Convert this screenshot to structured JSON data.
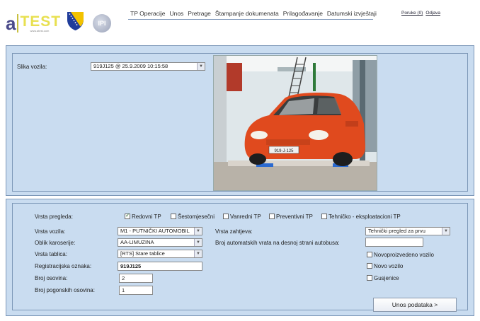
{
  "logo": {
    "letter": "a",
    "word": "TEST",
    "sub": "www.atest.com",
    "badge": "IPI"
  },
  "nav": {
    "items": [
      "TP Operacije",
      "Unos",
      "Pretrage",
      "Štampanje dokumenata",
      "Prilagođavanje",
      "Datumski izvještaji"
    ],
    "messages": "Poruke (0)",
    "logout": "Odjava"
  },
  "vehicle_image": {
    "label": "Slika vozila:",
    "selected": "919J125 @ 25.9.2009 10:15:58",
    "plate_text": "919-J-125"
  },
  "form": {
    "inspection_type_label": "Vrsta pregleda:",
    "inspection_types": [
      {
        "label": "Redovni TP",
        "checked": true
      },
      {
        "label": "Šestomjesečni",
        "checked": false
      },
      {
        "label": "Vanredni TP",
        "checked": false
      },
      {
        "label": "Preventivni TP",
        "checked": false
      },
      {
        "label": "Tehničko - eksploatacioni TP",
        "checked": false
      }
    ],
    "vehicle_type_label": "Vrsta vozila:",
    "vehicle_type_value": "M1 - PUTNIČKI AUTOMOBIL",
    "body_shape_label": "Oblik karoserije:",
    "body_shape_value": "AA-LIMUZINA",
    "plate_type_label": "Vrsta tablica:",
    "plate_type_value": "[RTS] Stare tablice",
    "registration_label": "Registracijska oznaka:",
    "registration_value": "919J125",
    "axles_label": "Broj osovina:",
    "axles_value": "2",
    "drive_axles_label": "Broj pogonskih osovina:",
    "drive_axles_value": "1",
    "request_type_label": "Vrsta zahtjeva:",
    "request_type_value": "Tehnički pregled za prvu",
    "doors_label": "Broj automatskih vrata na desnoj strani autobusa:",
    "doors_value": "",
    "new_manufactured_label": "Novoproizvedeno vozilo",
    "new_vehicle_label": "Novo vozilo",
    "tracks_label": "Gusjenice",
    "submit_label": "Unos podataka >"
  }
}
